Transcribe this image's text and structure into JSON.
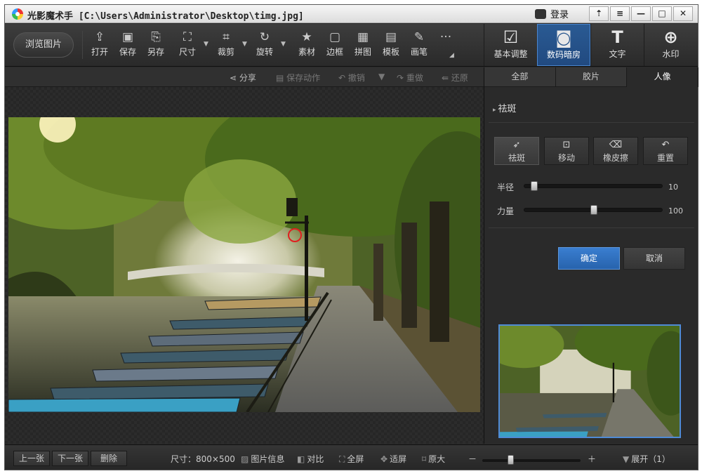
{
  "window": {
    "title": "光影魔术手  [C:\\Users\\Administrator\\Desktop\\timg.jpg]",
    "login": "登录",
    "controls": [
      "▲▼",
      "▼",
      "—",
      "□",
      "✕"
    ]
  },
  "toolbar": {
    "browse": "浏览图片",
    "tools": [
      {
        "label": "打开",
        "icon": "open-icon"
      },
      {
        "label": "保存",
        "icon": "save-icon"
      },
      {
        "label": "另存",
        "icon": "save-as-icon"
      },
      {
        "label": "尺寸",
        "icon": "resize-icon"
      },
      {
        "label": "裁剪",
        "icon": "crop-icon"
      },
      {
        "label": "旋转",
        "icon": "rotate-icon"
      },
      {
        "label": "素材",
        "icon": "material-icon"
      },
      {
        "label": "边框",
        "icon": "frame-icon"
      },
      {
        "label": "拼图",
        "icon": "collage-icon"
      },
      {
        "label": "模板",
        "icon": "template-icon"
      },
      {
        "label": "画笔",
        "icon": "brush-icon"
      }
    ],
    "more": "···",
    "modes": [
      {
        "label": "基本调整",
        "icon": "adjust-icon"
      },
      {
        "label": "数码暗房",
        "icon": "darkroom-icon"
      },
      {
        "label": "文字",
        "icon": "text-icon"
      },
      {
        "label": "水印",
        "icon": "watermark-icon"
      }
    ]
  },
  "actions": {
    "share": "分享",
    "save_action": "保存动作",
    "undo": "撤销",
    "redo": "重做",
    "restore": "还原"
  },
  "panel": {
    "tabs": [
      "全部",
      "胶片",
      "人像"
    ],
    "section": "祛斑",
    "tools": [
      {
        "label": "祛斑",
        "icon": "spot-cursor-icon"
      },
      {
        "label": "移动",
        "icon": "move-icon"
      },
      {
        "label": "橡皮擦",
        "icon": "eraser-icon"
      },
      {
        "label": "重置",
        "icon": "reset-icon"
      }
    ],
    "radius_label": "半径",
    "radius_value": "10",
    "radius_fraction": 0.05,
    "strength_label": "力量",
    "strength_value": "100",
    "strength_fraction": 0.5,
    "ok": "确定",
    "cancel": "取消"
  },
  "statusbar": {
    "prev": "上一张",
    "next": "下一张",
    "delete": "删除",
    "size": "尺寸：800×500",
    "info": "图片信息",
    "compare": "对比",
    "fullscreen": "全屏",
    "fit": "适屏",
    "original": "原大",
    "zoom_minus": "－",
    "zoom_plus": "＋",
    "expand": "展开（1）"
  },
  "colors": {
    "accent": "#2763ad",
    "brush_marker": "#e02020"
  }
}
